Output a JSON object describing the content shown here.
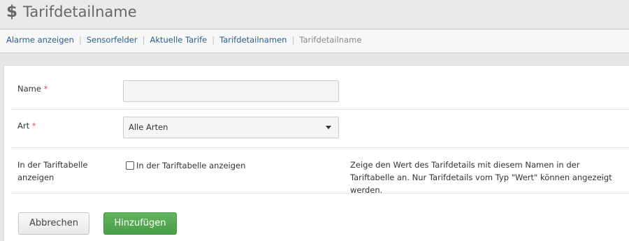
{
  "header": {
    "icon": "dollar-icon",
    "icon_glyph": "$",
    "title": "Tarifdetailname"
  },
  "breadcrumb": {
    "items": [
      "Alarme anzeigen",
      "Sensorfelder",
      "Aktuelle Tarife",
      "Tarifdetailnamen"
    ],
    "current": "Tarifdetailname",
    "separator": "|"
  },
  "form": {
    "name": {
      "label": "Name",
      "required_mark": "*",
      "value": ""
    },
    "art": {
      "label": "Art",
      "required_mark": "*",
      "selected": "Alle Arten"
    },
    "show_in_table": {
      "label": "In der Tariftabelle anzeigen",
      "checkbox_label": "In der Tariftabelle anzeigen",
      "checked": false,
      "help": "Zeige den Wert des Tarifdetails mit diesem Namen in der Tariftabelle an. Nur Tarifdetails vom Typ \"Wert\" können angezeigt werden."
    }
  },
  "actions": {
    "cancel_label": "Abbrechen",
    "add_label": "Hinzufügen"
  },
  "colors": {
    "link": "#2b5d8f",
    "required": "#d9534f",
    "primary_button": "#4fa64d"
  }
}
